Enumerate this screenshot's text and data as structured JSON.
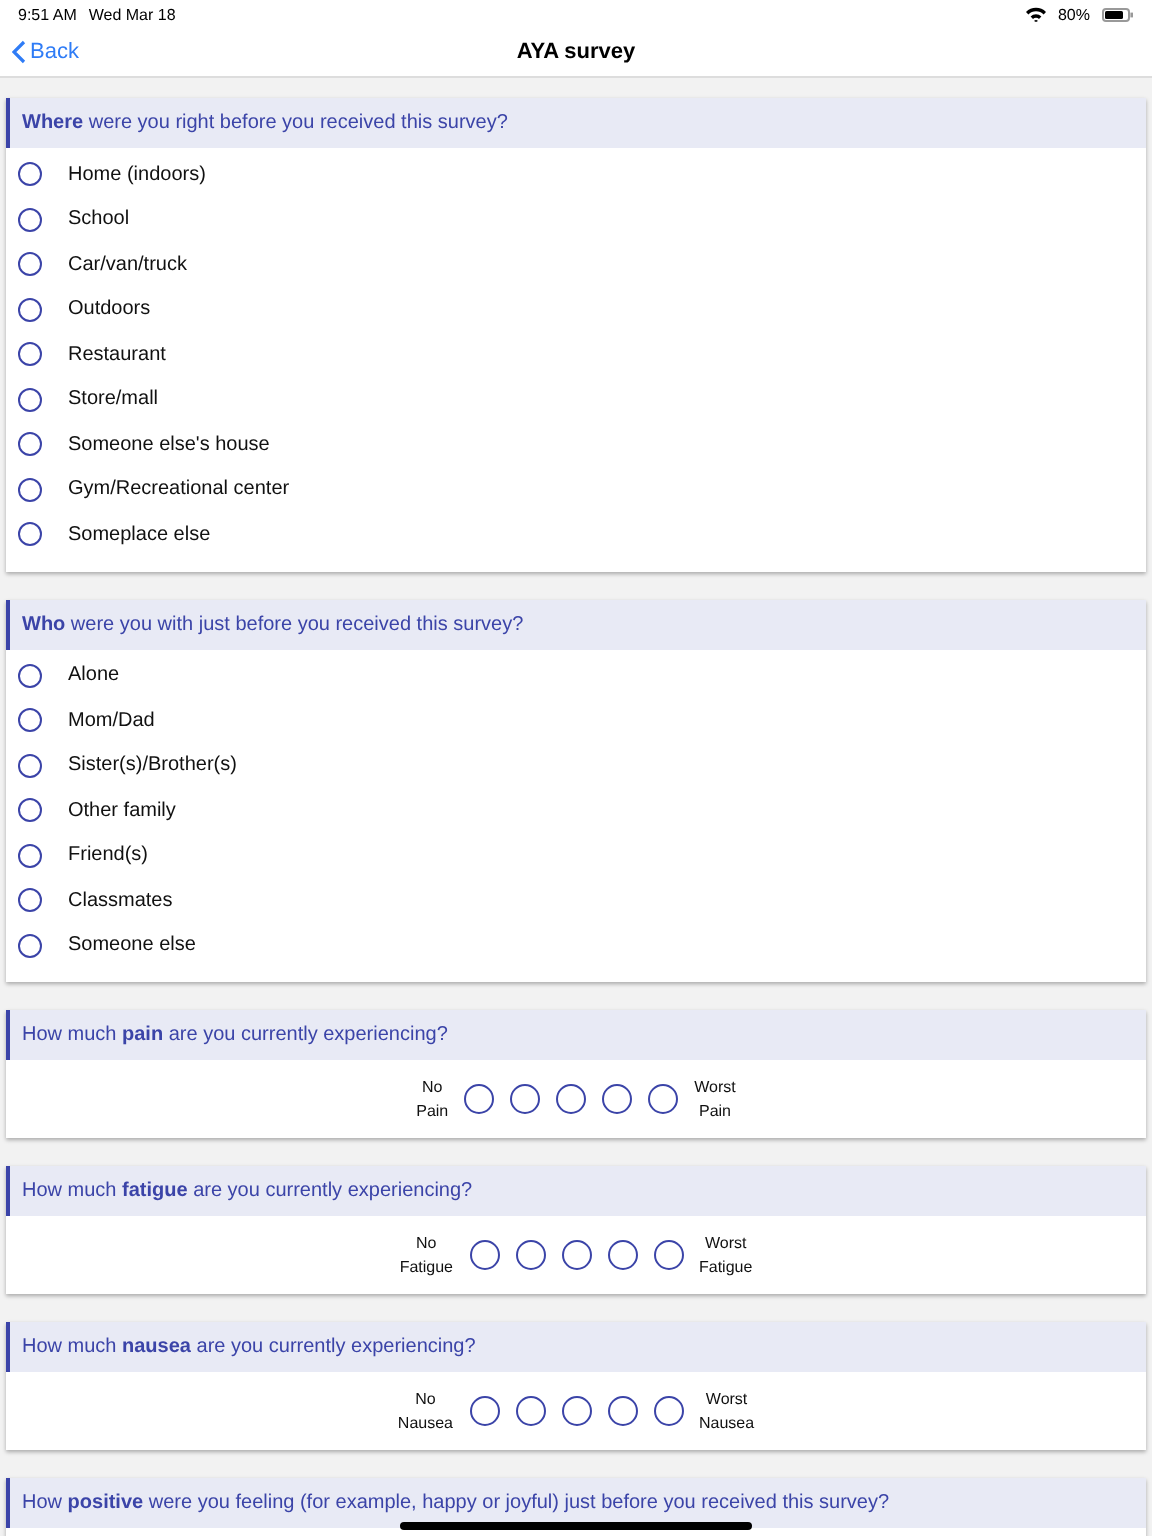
{
  "status_bar": {
    "time": "9:51 AM",
    "date": "Wed Mar 18",
    "battery": "80%"
  },
  "nav": {
    "back": "Back",
    "title": "AYA survey"
  },
  "questions": [
    {
      "kind": "choice",
      "text": "**Where** were you right before you received this survey?",
      "options": [
        {
          "label": "Home (indoors)",
          "selected": false
        },
        {
          "label": "School",
          "selected": false
        },
        {
          "label": "Car/van/truck",
          "selected": false
        },
        {
          "label": "Outdoors",
          "selected": false
        },
        {
          "label": "Restaurant",
          "selected": false
        },
        {
          "label": "Store/mall",
          "selected": false
        },
        {
          "label": "Someone else's house",
          "selected": false
        },
        {
          "label": "Gym/Recreational center",
          "selected": false
        },
        {
          "label": "Someplace else",
          "selected": false
        }
      ]
    },
    {
      "kind": "choice",
      "text": "**Who** were you with just before you received this survey?",
      "options": [
        {
          "label": "Alone",
          "selected": false
        },
        {
          "label": "Mom/Dad",
          "selected": false
        },
        {
          "label": "Sister(s)/Brother(s)",
          "selected": false
        },
        {
          "label": "Other family",
          "selected": false
        },
        {
          "label": "Friend(s)",
          "selected": false
        },
        {
          "label": "Classmates",
          "selected": false
        },
        {
          "label": "Someone else",
          "selected": false
        }
      ]
    },
    {
      "kind": "scale",
      "text": "How much **pain** are you currently experiencing?",
      "low": [
        "No",
        "Pain"
      ],
      "high": [
        "Worst",
        "Pain"
      ],
      "points": [
        {
          "selected": false
        },
        {
          "selected": false
        },
        {
          "selected": false
        },
        {
          "selected": false
        },
        {
          "selected": false
        }
      ]
    },
    {
      "kind": "scale",
      "text": "How much **fatigue** are you currently experiencing?",
      "low": [
        "No",
        "Fatigue"
      ],
      "high": [
        "Worst",
        "Fatigue"
      ],
      "points": [
        {
          "selected": false
        },
        {
          "selected": false
        },
        {
          "selected": false
        },
        {
          "selected": false
        },
        {
          "selected": false
        }
      ]
    },
    {
      "kind": "scale",
      "text": "How much **nausea** are you currently experiencing?",
      "low": [
        "No",
        "Nausea"
      ],
      "high": [
        "Worst",
        "Nausea"
      ],
      "points": [
        {
          "selected": false
        },
        {
          "selected": false
        },
        {
          "selected": false
        },
        {
          "selected": false
        },
        {
          "selected": false
        }
      ]
    },
    {
      "kind": "scale",
      "text": "How **positive** were you feeling (for example, happy or joyful) just before you received this survey?"
    }
  ]
}
